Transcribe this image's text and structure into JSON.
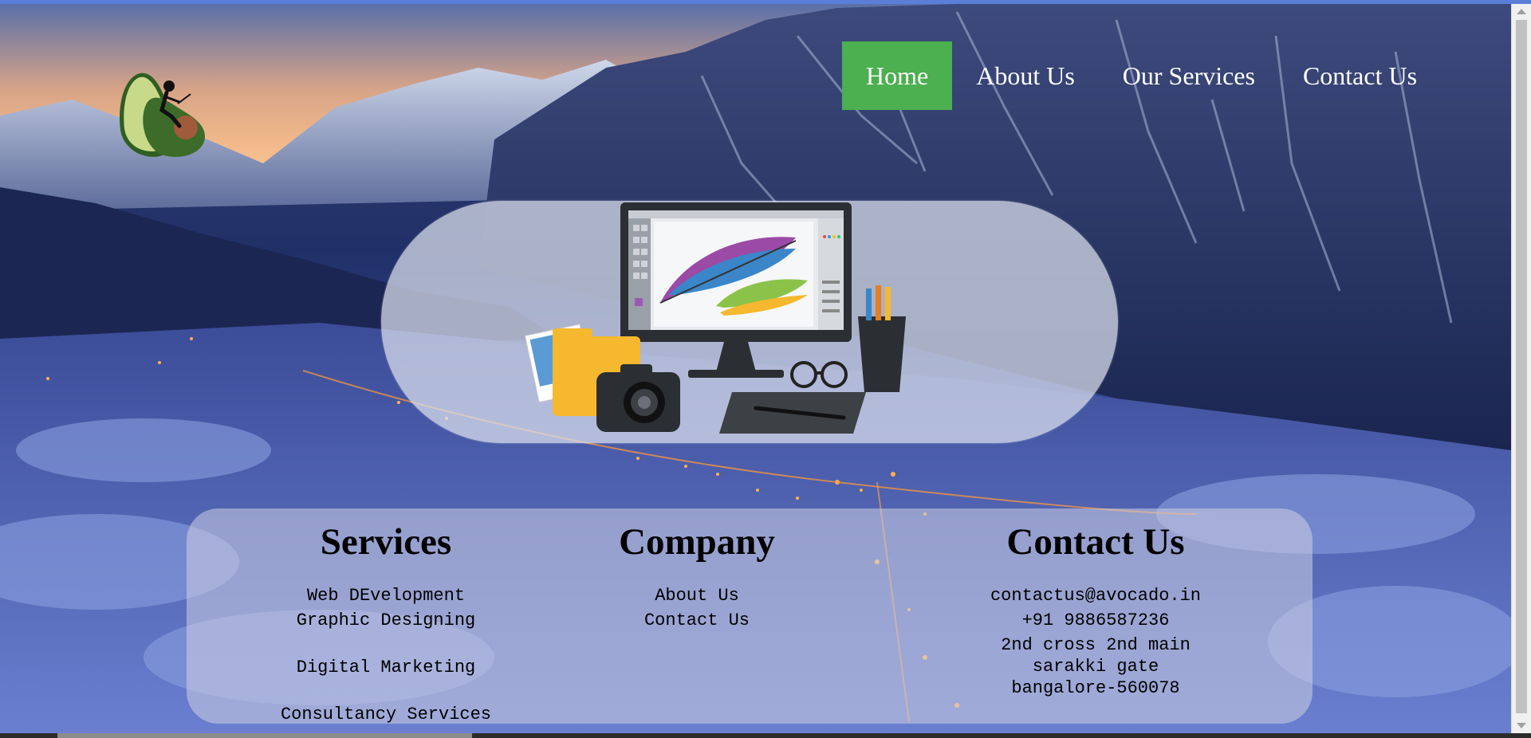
{
  "nav": {
    "items": [
      {
        "label": "Home",
        "active": true
      },
      {
        "label": "About Us",
        "active": false
      },
      {
        "label": "Our Services",
        "active": false
      },
      {
        "label": "Contact Us",
        "active": false
      }
    ],
    "active_color": "#4caf50"
  },
  "logo": {
    "icon": "avocado-person-laptop-icon"
  },
  "hero": {
    "illustration": "graphic-design-workspace-illustration"
  },
  "footer": {
    "services": {
      "title": "Services",
      "items": [
        "Web DEvelopment",
        "Graphic Designing",
        "Digital Marketing",
        "Consultancy Services"
      ]
    },
    "company": {
      "title": "Company",
      "items": [
        "About Us",
        "Contact Us"
      ]
    },
    "contact": {
      "title": "Contact Us",
      "email": "contactus@avocado.in",
      "phone": "+91 9886587236",
      "address": [
        "2nd cross 2nd main",
        "sarakki gate",
        "bangalore-560078"
      ]
    }
  }
}
